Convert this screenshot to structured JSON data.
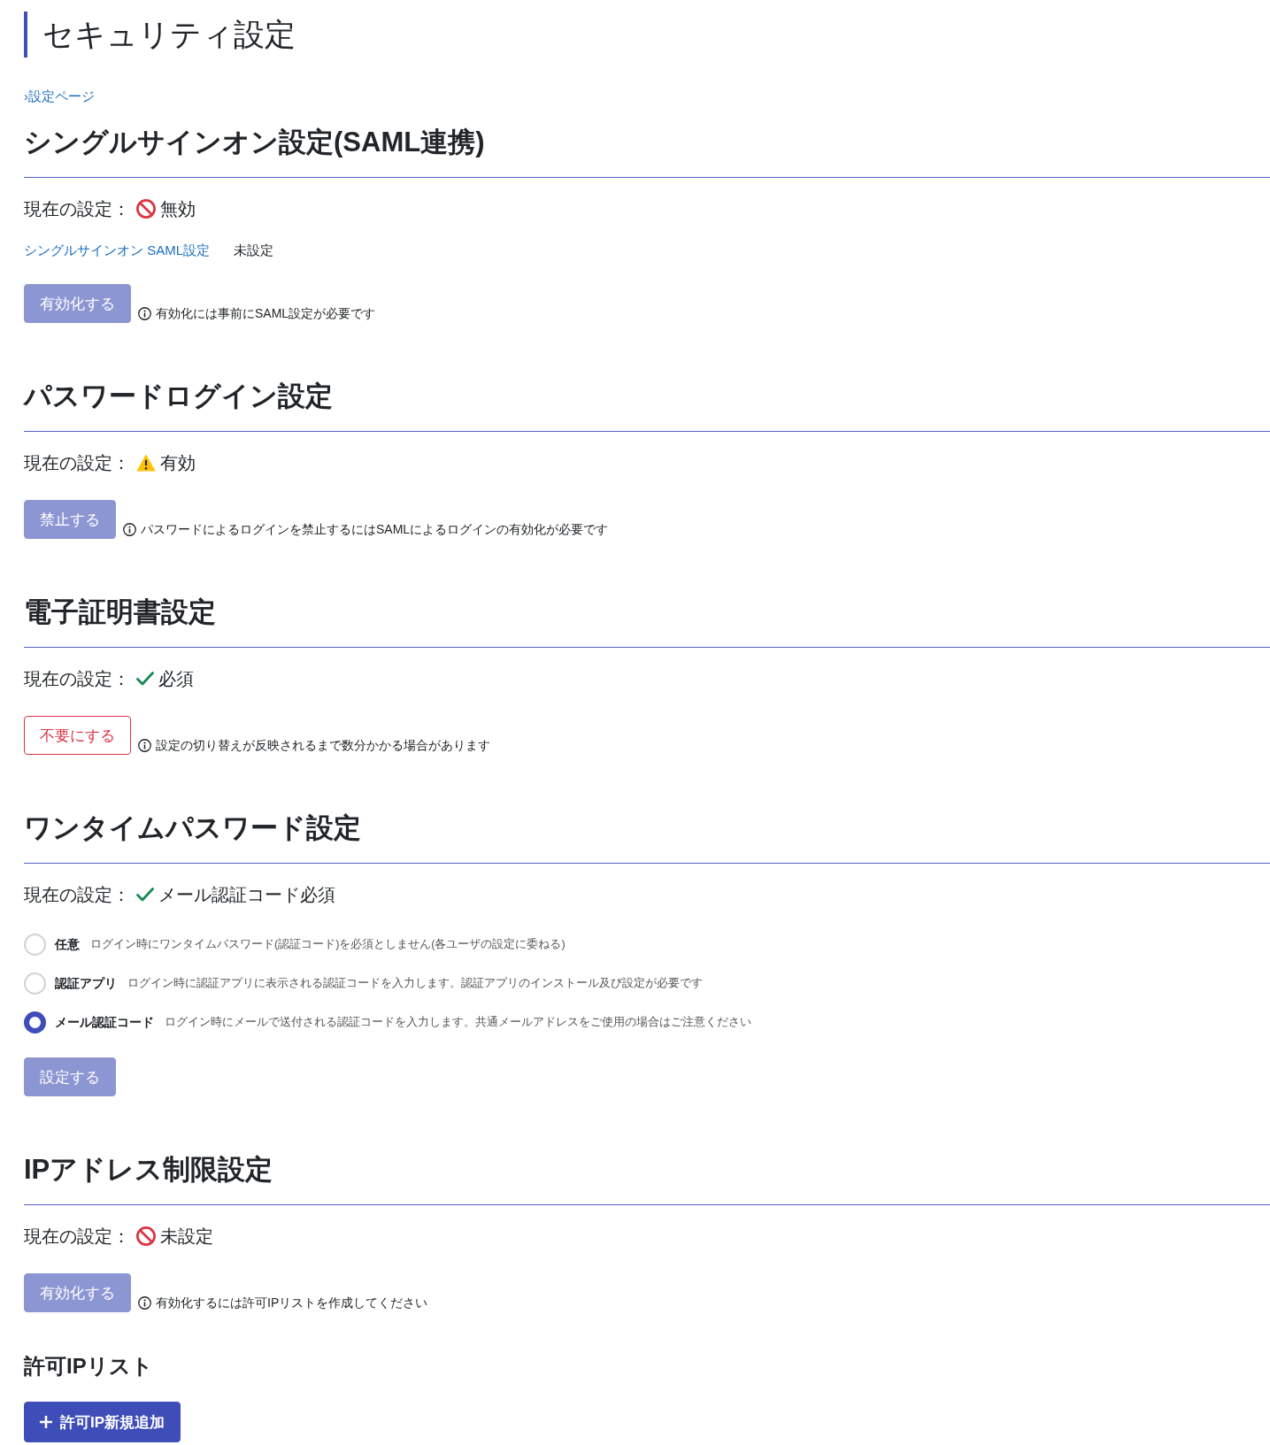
{
  "page": {
    "title": "セキュリティ設定",
    "breadcrumb": "›設定ページ"
  },
  "sections": [
    {
      "title": "シングルサインオン設定(SAML連携)",
      "status": {
        "label": "現在の設定：",
        "kind": "prohibited",
        "value": "無効"
      },
      "saml_link": {
        "label": "シングルサインオン SAML設定",
        "value": "未設定"
      },
      "action": {
        "label": "有効化する",
        "kind": "primary",
        "disabled": true
      },
      "note": "有効化には事前にSAML設定が必要です"
    },
    {
      "title": "パスワードログイン設定",
      "status": {
        "label": "現在の設定：",
        "kind": "warning",
        "value": "有効"
      },
      "action": {
        "label": "禁止する",
        "kind": "primary",
        "disabled": true
      },
      "note": "パスワードによるログインを禁止するにはSAMLによるログインの有効化が必要です"
    },
    {
      "title": "電子証明書設定",
      "status": {
        "label": "現在の設定：",
        "kind": "check",
        "value": "必須"
      },
      "action": {
        "label": "不要にする",
        "kind": "danger",
        "disabled": false
      },
      "note": "設定の切り替えが反映されるまで数分かかる場合があります"
    },
    {
      "title": "ワンタイムパスワード設定",
      "status": {
        "label": "現在の設定：",
        "kind": "check",
        "value": "メール認証コード必須"
      },
      "options": [
        {
          "label": "任意",
          "description": "ログイン時にワンタイムパスワード(認証コード)を必須としません(各ユーザの設定に委ねる)",
          "selected": false
        },
        {
          "label": "認証アプリ",
          "description": "ログイン時に認証アプリに表示される認証コードを入力します。認証アプリのインストール及び設定が必要です",
          "selected": false
        },
        {
          "label": "メール認証コード",
          "description": "ログイン時にメールで送付される認証コードを入力します。共通メールアドレスをご使用の場合はご注意ください",
          "selected": true
        }
      ],
      "action": {
        "label": "設定する",
        "kind": "primary",
        "disabled": true
      }
    },
    {
      "title": "IPアドレス制限設定",
      "status": {
        "label": "現在の設定：",
        "kind": "prohibited",
        "value": "未設定"
      },
      "action": {
        "label": "有効化する",
        "kind": "primary",
        "disabled": true
      },
      "note": "有効化するには許可IPリストを作成してください",
      "allowlist": {
        "title": "許可IPリスト",
        "add_button": {
          "label": "許可IP新規追加",
          "disabled": false
        }
      }
    }
  ]
}
